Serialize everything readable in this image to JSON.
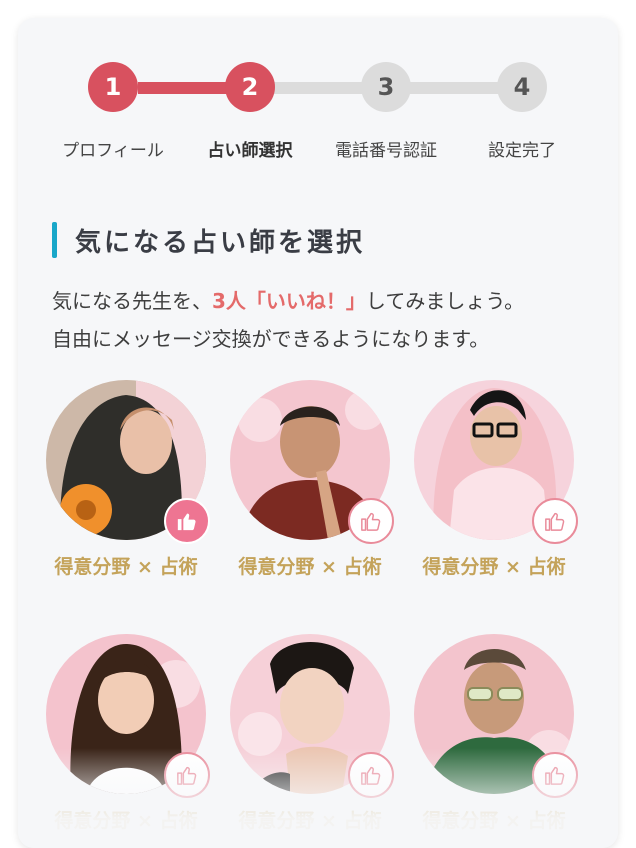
{
  "stepper": {
    "steps": [
      {
        "number": "1",
        "label": "プロフィール",
        "state": "done"
      },
      {
        "number": "2",
        "label": "占い師選択",
        "state": "current"
      },
      {
        "number": "3",
        "label": "電話番号認証",
        "state": "todo"
      },
      {
        "number": "4",
        "label": "設定完了",
        "state": "todo"
      }
    ]
  },
  "section": {
    "title": "気になる占い師を選択",
    "desc_before": "気になる先生を、",
    "desc_highlight": "3人「いいね！」",
    "desc_after": "してみましょう。",
    "desc_line2": "自由にメッセージ交換ができるようになります。"
  },
  "fortune_tellers": [
    {
      "specialty": "得意分野 × 占術",
      "liked": true
    },
    {
      "specialty": "得意分野 × 占術",
      "liked": false
    },
    {
      "specialty": "得意分野 × 占術",
      "liked": false
    },
    {
      "specialty": "得意分野 × 占術",
      "liked": false
    },
    {
      "specialty": "得意分野 × 占術",
      "liked": false
    },
    {
      "specialty": "得意分野 × 占術",
      "liked": false
    }
  ],
  "colors": {
    "accent": "#d8515f",
    "inactive": "#dcdcdc",
    "title_bar": "#19a7c9",
    "highlight": "#e46a6a",
    "specialty": "#c4a35a",
    "like_on": "#ee7592",
    "like_border": "#e98b9a"
  },
  "icons": {
    "like": "thumbs-up-icon"
  }
}
